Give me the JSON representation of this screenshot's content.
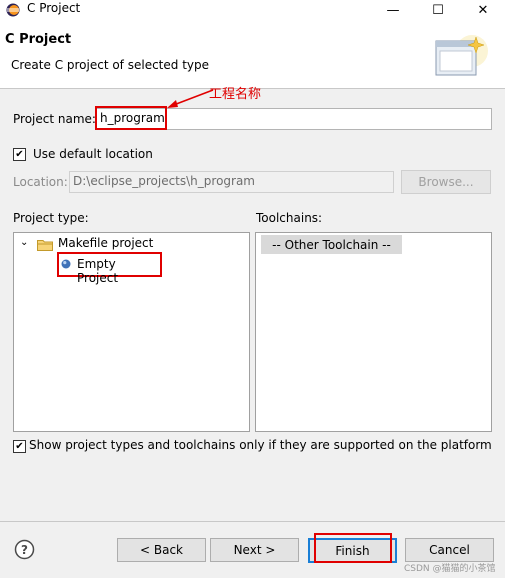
{
  "window": {
    "title": "C Project",
    "controls": {
      "minimize": "—",
      "maximize": "☐",
      "close": "✕"
    }
  },
  "header": {
    "title": "C Project",
    "description": "Create C project of selected type"
  },
  "annotation": {
    "text": "工程名称",
    "color": "#e00000"
  },
  "project_name": {
    "label": "Project name:",
    "value": "h_program"
  },
  "use_default_location": {
    "label": "Use default location",
    "checked": true
  },
  "location": {
    "label": "Location:",
    "value": "D:\\eclipse_projects\\h_program",
    "browse_label": "Browse..."
  },
  "project_type": {
    "label": "Project type:",
    "tree": [
      {
        "label": "Makefile project",
        "icon": "folder-icon",
        "expanded": true,
        "children": [
          {
            "label": "Empty Project",
            "icon": "project-bullet-icon",
            "selected": true
          }
        ]
      }
    ]
  },
  "toolchains": {
    "label": "Toolchains:",
    "items": [
      "-- Other Toolchain --"
    ]
  },
  "show_supported": {
    "label": "Show project types and toolchains only if they are supported on the platform",
    "checked": true
  },
  "buttons": {
    "back": "< Back",
    "next": "Next >",
    "finish": "Finish",
    "cancel": "Cancel"
  },
  "help_icon": "question-circle-icon",
  "watermark": "CSDN @猫猫的小茶馆",
  "colors": {
    "highlight_red": "#e00000",
    "focus_blue": "#1a7fd6",
    "selection_bg": "#d9d9d9"
  }
}
